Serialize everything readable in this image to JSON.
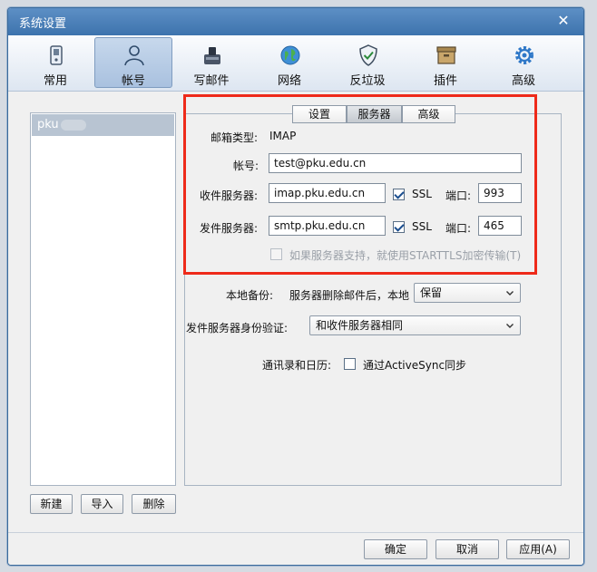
{
  "window": {
    "title": "系统设置",
    "close_glyph": "✕"
  },
  "toolbar": [
    {
      "label": "常用",
      "icon": "phone-icon"
    },
    {
      "label": "帐号",
      "icon": "user-icon",
      "active": true
    },
    {
      "label": "写邮件",
      "icon": "ink-icon"
    },
    {
      "label": "网络",
      "icon": "globe-icon"
    },
    {
      "label": "反垃圾",
      "icon": "shield-icon"
    },
    {
      "label": "插件",
      "icon": "box-icon"
    },
    {
      "label": "高级",
      "icon": "gear-icon"
    }
  ],
  "accounts": {
    "items": [
      {
        "label": "pku"
      }
    ]
  },
  "account_buttons": {
    "new": "新建",
    "import": "导入",
    "delete": "删除"
  },
  "tabs": [
    {
      "label": "设置"
    },
    {
      "label": "服务器",
      "active": true
    },
    {
      "label": "高级"
    }
  ],
  "server": {
    "mailbox_type_label": "邮箱类型:",
    "mailbox_type_value": "IMAP",
    "account_label": "帐号:",
    "account_value": "test@pku.edu.cn",
    "incoming_label": "收件服务器:",
    "incoming_value": "imap.pku.edu.cn",
    "incoming_ssl_label": "SSL",
    "incoming_ssl_checked": true,
    "incoming_port_label": "端口:",
    "incoming_port_value": "993",
    "outgoing_label": "发件服务器:",
    "outgoing_value": "smtp.pku.edu.cn",
    "outgoing_ssl_label": "SSL",
    "outgoing_ssl_checked": true,
    "outgoing_port_label": "端口:",
    "outgoing_port_value": "465",
    "starttls_label": "如果服务器支持，就使用STARTTLS加密传输(T)",
    "starttls_checked": false
  },
  "options": {
    "backup_label": "本地备份:",
    "backup_desc": "服务器删除邮件后，本地",
    "backup_value": "保留",
    "auth_label": "发件服务器身份验证:",
    "auth_value": "和收件服务器相同",
    "sync_label": "通讯录和日历:",
    "sync_checkbox_label": "通过ActiveSync同步",
    "sync_checked": false
  },
  "footer": {
    "ok": "确定",
    "cancel": "取消",
    "apply": "应用(A)"
  },
  "colors": {
    "highlight": "#ee2a1a",
    "titlebar": "#3d73ad",
    "selected_item": "#b8c4d2"
  }
}
